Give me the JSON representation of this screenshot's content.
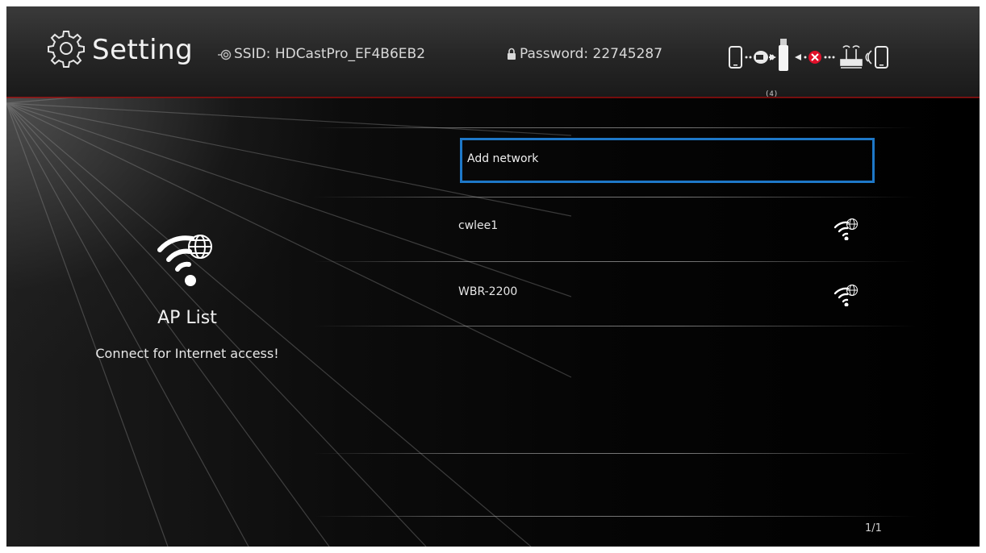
{
  "header": {
    "title": "Setting",
    "ssid": "SSID: HDCastPro_EF4B6EB2",
    "password": "Password: 22745287",
    "connection_count": "(4)",
    "accent_color": "#8a1010"
  },
  "left_panel": {
    "icon": "wifi-globe-icon",
    "title": "AP List",
    "subtitle": "Connect for Internet access!"
  },
  "network_list": {
    "add_network_label": "Add network",
    "items": [
      {
        "name": "cwlee1",
        "icon": "wifi-globe-icon"
      },
      {
        "name": "WBR-2200",
        "icon": "wifi-globe-icon"
      }
    ],
    "selection_color": "#1e78c8"
  },
  "pagination": {
    "indicator": "1/1"
  }
}
